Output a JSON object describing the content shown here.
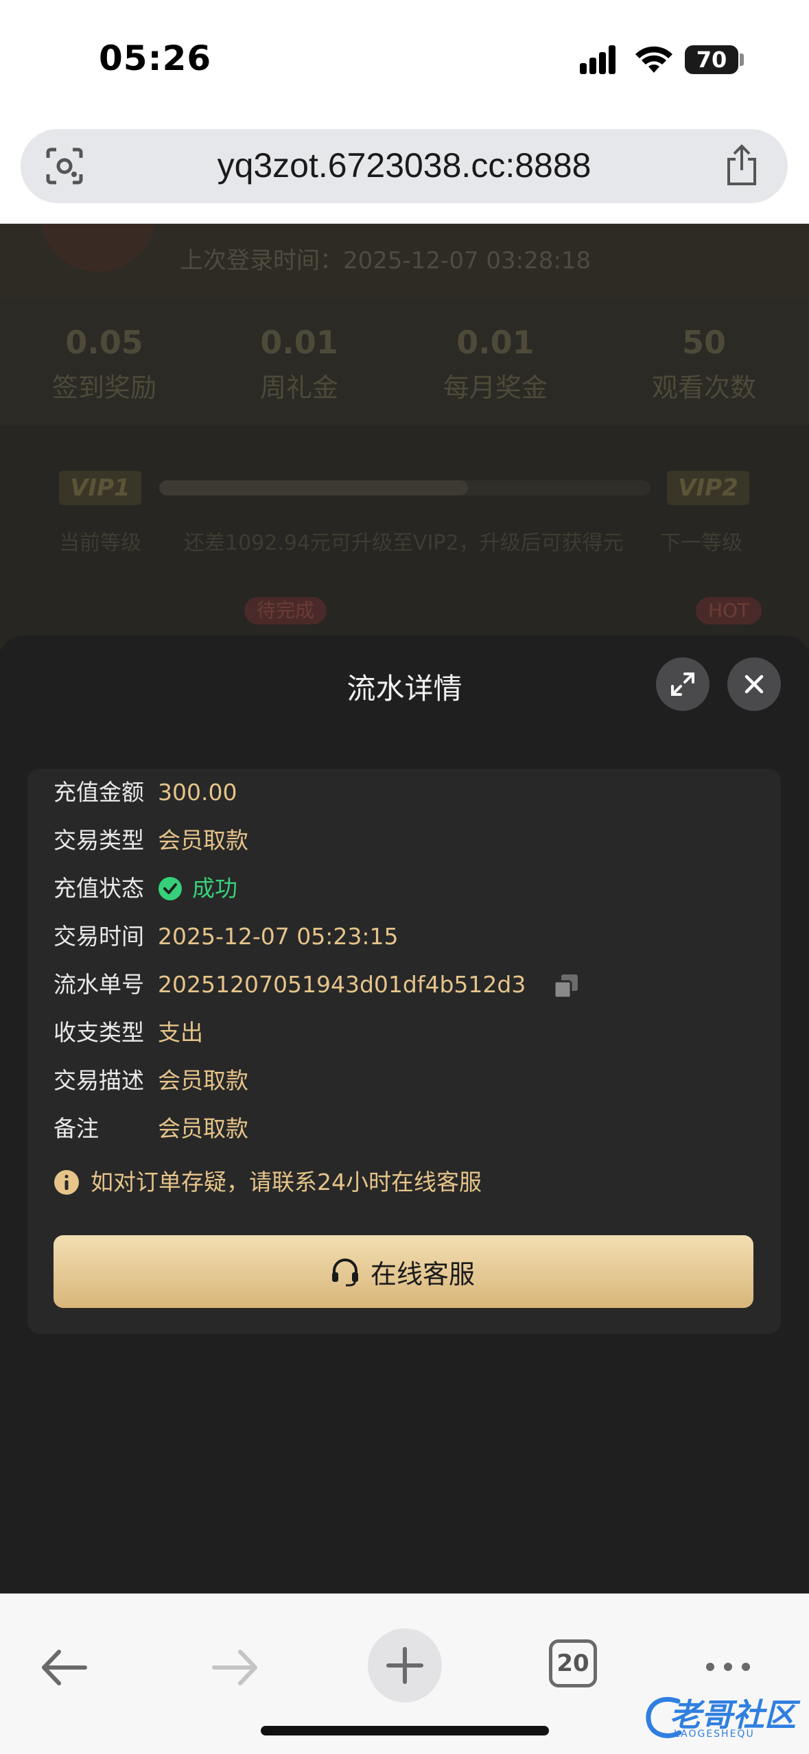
{
  "status_bar": {
    "time": "05:26",
    "battery": "70"
  },
  "browser": {
    "url": "yq3zot.6723038.cc:8888",
    "tab_count": "20"
  },
  "background_page": {
    "last_login": "上次登录时间：2025-12-07 03:28:18",
    "stats": [
      {
        "value": "0.05",
        "label": "签到奖励"
      },
      {
        "value": "0.01",
        "label": "周礼金"
      },
      {
        "value": "0.01",
        "label": "每月奖金"
      },
      {
        "value": "50",
        "label": "观看次数"
      }
    ],
    "vip_current": "VIP1",
    "vip_next": "VIP2",
    "current_level": "当前等级",
    "upgrade_hint": "还差1092.94元可升级至VIP2，升级后可获得元",
    "next_level": "下一等级",
    "badge_pending": "待完成",
    "badge_hot": "HOT"
  },
  "sheet": {
    "title": "流水详情",
    "rows": [
      {
        "key": "充值金额",
        "value": "300.00"
      },
      {
        "key": "交易类型",
        "value": "会员取款"
      },
      {
        "key": "充值状态",
        "value": "成功"
      },
      {
        "key": "交易时间",
        "value": "2025-12-07 05:23:15"
      },
      {
        "key": "流水单号",
        "value": "20251207051943d01df4b512d3"
      },
      {
        "key": "收支类型",
        "value": "支出"
      },
      {
        "key": "交易描述",
        "value": "会员取款"
      },
      {
        "key": "备注",
        "value": "会员取款"
      }
    ],
    "notice": "如对订单存疑，请联系24小时在线客服",
    "cs_button": "在线客服"
  },
  "watermark": {
    "text": "老哥社区",
    "sub": "LAOGESHEQU"
  },
  "colors": {
    "accent_gold": "#e6c48a",
    "success_green": "#37d07a",
    "sheet_bg": "#1f1f20",
    "card_bg": "#282828"
  }
}
